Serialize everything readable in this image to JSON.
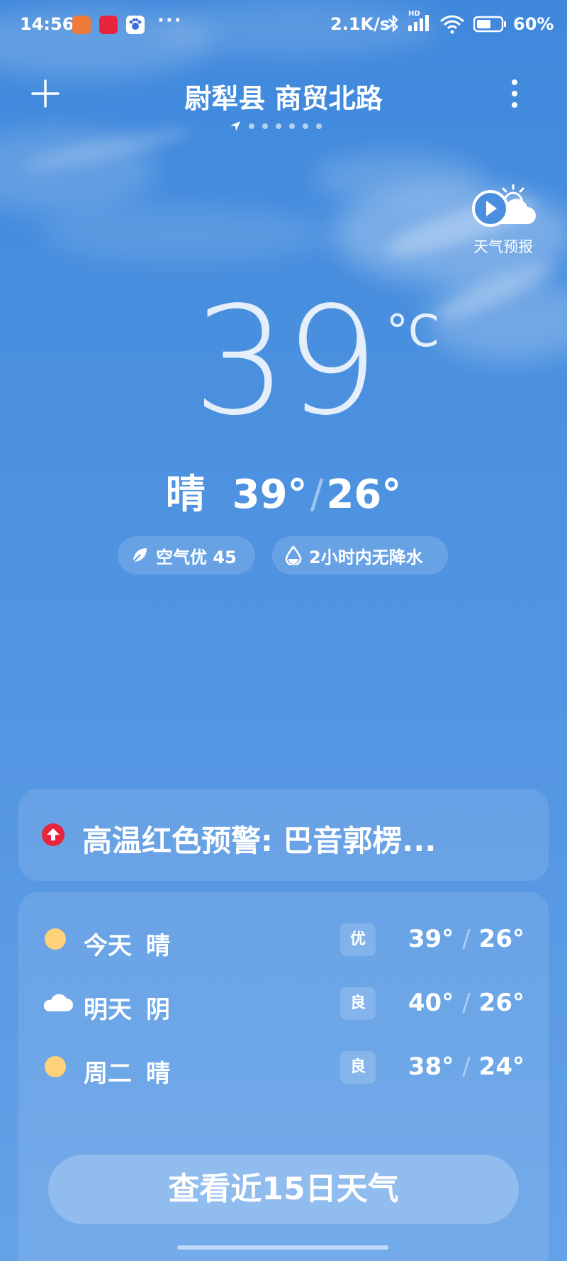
{
  "status_bar": {
    "time": "14:56",
    "dots": "···",
    "net_speed": "2.1K/s",
    "hd_label": "HD",
    "battery_percent": "60%",
    "battery_level": 0.6
  },
  "header": {
    "location": "尉犁县 商贸北路",
    "page_count": 7,
    "current_page": 0
  },
  "forecast_video": {
    "label": "天气预报"
  },
  "current": {
    "temperature": "39",
    "unit": "°C",
    "condition": "晴",
    "high": "39°",
    "low": "26°",
    "separator": "/"
  },
  "pills": {
    "air": "空气优 45",
    "rain": "2小时内无降水"
  },
  "alert": {
    "text": "高温红色预警: 巴音郭楞..."
  },
  "forecast": [
    {
      "day": "今天",
      "condition": "晴",
      "aqi": "优",
      "high": "39°",
      "low": "26°",
      "icon": "sun-icon"
    },
    {
      "day": "明天",
      "condition": "阴",
      "aqi": "良",
      "high": "40°",
      "low": "26°",
      "icon": "cloud-icon"
    },
    {
      "day": "周二",
      "condition": "晴",
      "aqi": "良",
      "high": "38°",
      "low": "24°",
      "icon": "sun-icon"
    }
  ],
  "forecast_separator": "/",
  "view_15_days": "查看近15日天气",
  "colors": {
    "alert_red": "#e8253c",
    "sun_yellow": "#ffd27a"
  }
}
